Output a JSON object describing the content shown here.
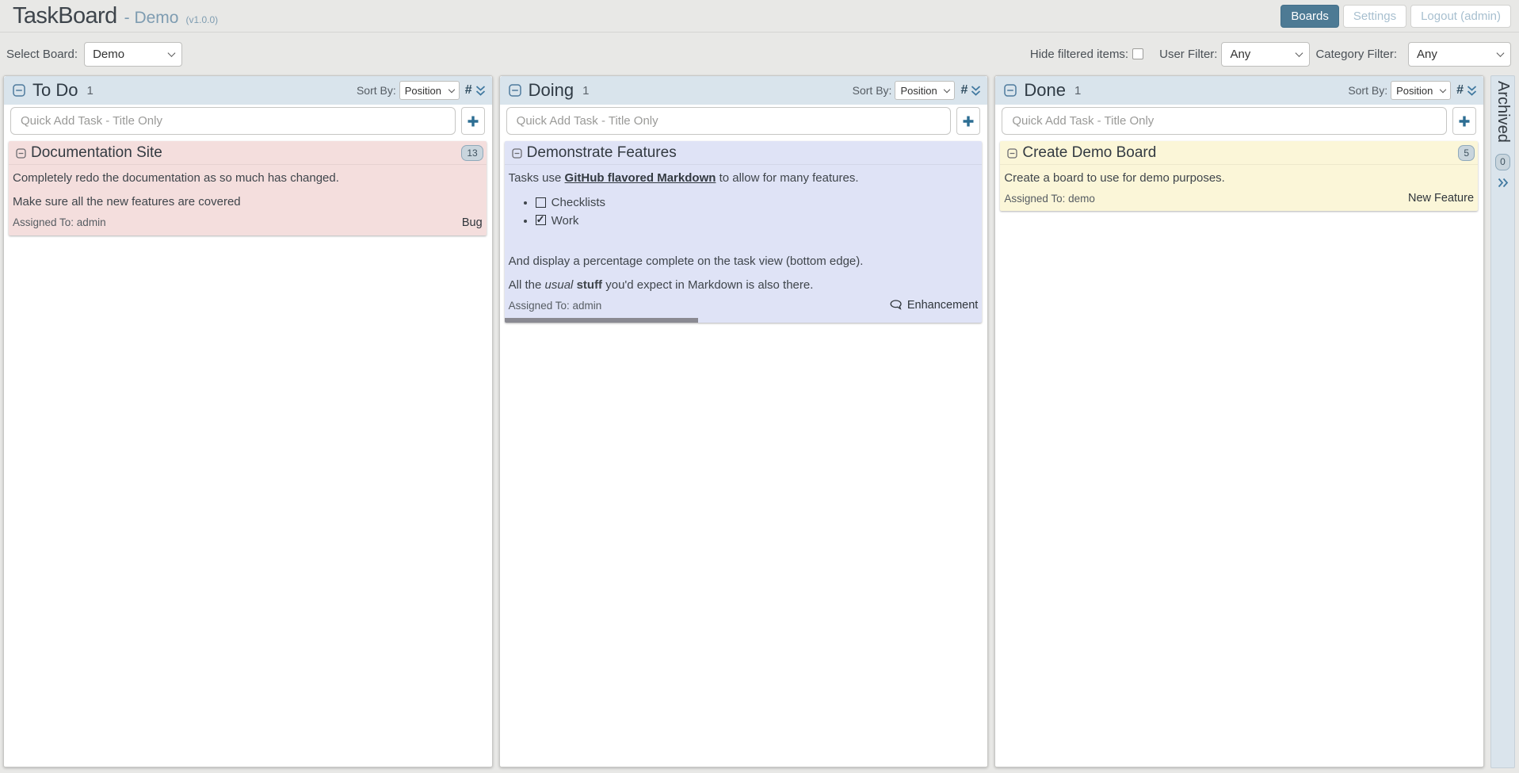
{
  "header": {
    "app_title": "TaskBoard",
    "board_name": "- Demo",
    "version": "(v1.0.0)",
    "buttons": {
      "boards": "Boards",
      "settings": "Settings",
      "logout": "Logout (admin)"
    }
  },
  "filter_bar": {
    "select_board_label": "Select Board:",
    "board_value": "Demo",
    "hide_filtered_label": "Hide filtered items:",
    "user_filter_label": "User Filter:",
    "user_filter_value": "Any",
    "category_filter_label": "Category Filter:",
    "category_filter_value": "Any"
  },
  "columns": [
    {
      "title": "To Do",
      "count": "1",
      "sort_label": "Sort By:",
      "sort_value": "Position",
      "quick_add_placeholder": "Quick Add Task - Title Only"
    },
    {
      "title": "Doing",
      "count": "1",
      "sort_label": "Sort By:",
      "sort_value": "Position",
      "quick_add_placeholder": "Quick Add Task - Title Only"
    },
    {
      "title": "Done",
      "count": "1",
      "sort_label": "Sort By:",
      "sort_value": "Position",
      "quick_add_placeholder": "Quick Add Task - Title Only"
    }
  ],
  "tasks": {
    "todo": {
      "title": "Documentation Site",
      "badge": "13",
      "color": "#f4dedd",
      "paragraph1": "Completely redo the documentation as so much has changed.",
      "paragraph2": "Make sure all the new features are covered",
      "assigned": "Assigned To: admin",
      "category": "Bug"
    },
    "doing": {
      "title": "Demonstrate Features",
      "color": "#dfe3f6",
      "intro_pre": "Tasks use ",
      "intro_link": "GitHub flavored Markdown",
      "intro_post": " to allow for many features.",
      "checklist": [
        {
          "checked": false,
          "label": "Checklists"
        },
        {
          "checked": true,
          "label": "Work"
        }
      ],
      "paragraph2": "And display a percentage complete on the task view (bottom edge).",
      "outro_pre": "All the ",
      "outro_italic": "usual",
      "outro_bold": "stuff",
      "outro_post": " you'd expect in Markdown is also there.",
      "assigned": "Assigned To: admin",
      "category": "Enhancement",
      "progress_percent": 40.6
    },
    "done": {
      "title": "Create Demo Board",
      "badge": "5",
      "color": "#fbf6d8",
      "paragraph1": "Create a board to use for demo purposes.",
      "assigned": "Assigned To: demo",
      "category": "New Feature"
    }
  },
  "archived": {
    "label": "Archived",
    "count": "0"
  }
}
